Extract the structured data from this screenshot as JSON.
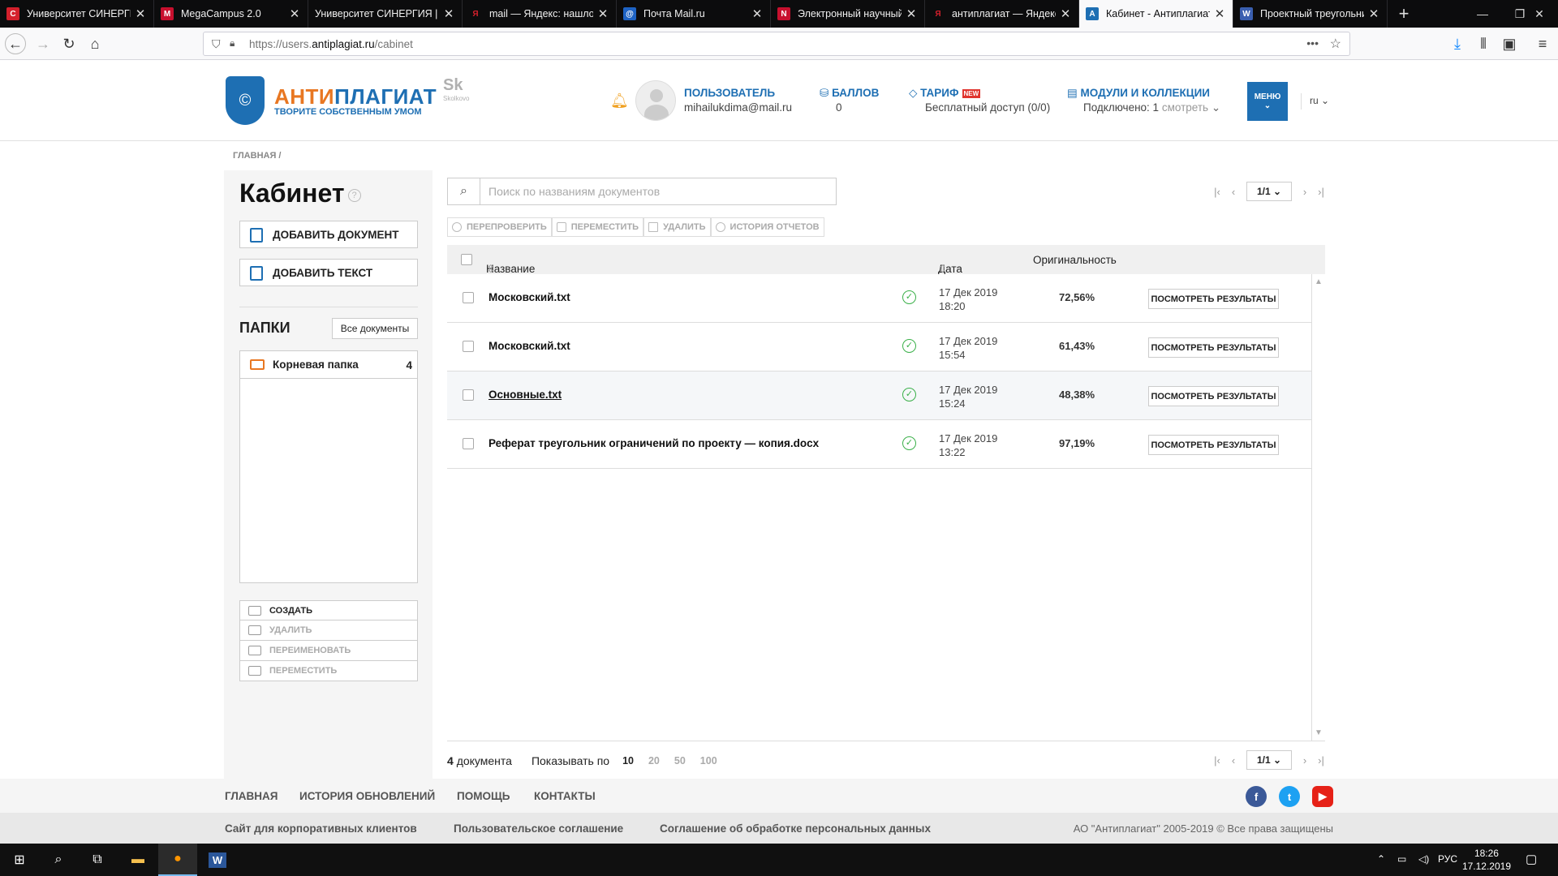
{
  "browser": {
    "tabs": [
      {
        "title": "Университет СИНЕРГИЯ",
        "favicon_color": "#d4202c",
        "favicon_glyph": "С"
      },
      {
        "title": "MegaCampus 2.0",
        "favicon_color": "#c8102e",
        "favicon_glyph": "M"
      },
      {
        "title": "Университет СИНЕРГИЯ | Э",
        "favicon_color": "#555555",
        "favicon_glyph": ""
      },
      {
        "title": "mail — Яндекс: нашлось",
        "favicon_color": "#d4202c",
        "favicon_glyph": "Я"
      },
      {
        "title": "Почта Mail.ru",
        "favicon_color": "#1e63c4",
        "favicon_glyph": "@"
      },
      {
        "title": "Электронный научный",
        "favicon_color": "#c8102e",
        "favicon_glyph": "N"
      },
      {
        "title": "антиплагиат — Яндекс",
        "favicon_color": "#d4202c",
        "favicon_glyph": "Я"
      },
      {
        "title": "Кабинет - Антиплагиат",
        "favicon_color": "#1e6fb3",
        "favicon_glyph": "А",
        "active": true
      },
      {
        "title": "Проектный треугольник",
        "favicon_color": "#3a5fb0",
        "favicon_glyph": "W"
      }
    ],
    "url_prefix": "https://users.",
    "url_domain": "antiplagiat.ru",
    "url_path": "/cabinet"
  },
  "header": {
    "logo_part1": "АНТИ",
    "logo_part2": "ПЛАГИАТ",
    "logo_slogan": "ТВОРИТЕ СОБСТВЕННЫМ УМОМ",
    "skolkovo": "Sk",
    "skolkovo_sub": "Skolkovo",
    "user_label": "ПОЛЬЗОВАТЕЛЬ",
    "user_email": "mihailukdima@mail.ru",
    "points_label": "БАЛЛОВ",
    "points_value": "0",
    "tariff_label": "ТАРИФ",
    "tariff_badge": "NEW",
    "tariff_value": "Бесплатный доступ (0/0)",
    "modules_label": "МОДУЛИ И КОЛЛЕКЦИИ",
    "modules_connected": "Подключено: 1",
    "modules_view": "смотреть",
    "menu_label": "МЕНЮ",
    "lang": "ru"
  },
  "breadcrumb": "ГЛАВНАЯ /",
  "sidebar": {
    "title": "Кабинет",
    "add_document": "ДОБАВИТЬ ДОКУМЕНТ",
    "add_text": "ДОБАВИТЬ ТЕКСТ",
    "folders_heading": "ПАПКИ",
    "all_documents": "Все документы",
    "folders": [
      {
        "name": "Корневая папка",
        "count": "4"
      }
    ],
    "folder_actions": [
      "СОЗДАТЬ",
      "УДАЛИТЬ",
      "ПЕРЕИМЕНОВАТЬ",
      "ПЕРЕМЕСТИТЬ"
    ]
  },
  "main": {
    "search_placeholder": "Поиск по названиям документов",
    "page_indicator": "1/1",
    "actions": [
      "ПЕРЕПРОВЕРИТЬ",
      "ПЕРЕМЕСТИТЬ",
      "УДАЛИТЬ",
      "ИСТОРИЯ ОТЧЕТОВ"
    ],
    "columns": {
      "name": "Название",
      "date": "Дата загрузки",
      "originality": "Оригинальность"
    },
    "rows": [
      {
        "name": "Московский.txt",
        "date": "17 Дек 2019",
        "time": "18:20",
        "originality": "72,56%",
        "action": "ПОСМОТРЕТЬ РЕЗУЛЬТАТЫ"
      },
      {
        "name": "Московский.txt",
        "date": "17 Дек 2019",
        "time": "15:54",
        "originality": "61,43%",
        "action": "ПОСМОТРЕТЬ РЕЗУЛЬТАТЫ"
      },
      {
        "name": "Основные.txt",
        "date": "17 Дек 2019",
        "time": "15:24",
        "originality": "48,38%",
        "action": "ПОСМОТРЕТЬ РЕЗУЛЬТАТЫ"
      },
      {
        "name": "Реферат треугольник ограничений по проекту — копия.docx",
        "date": "17 Дек 2019",
        "time": "13:22",
        "originality": "97,19%",
        "action": "ПОСМОТРЕТЬ РЕЗУЛЬТАТЫ"
      }
    ],
    "doc_count": "4",
    "doc_count_label": "документа",
    "show_by_label": "Показывать по",
    "page_sizes": [
      "10",
      "20",
      "50",
      "100"
    ]
  },
  "footer": {
    "links": [
      "ГЛАВНАЯ",
      "ИСТОРИЯ ОБНОВЛЕНИЙ",
      "ПОМОЩЬ",
      "КОНТАКТЫ"
    ],
    "links2": [
      "Сайт для корпоративных клиентов",
      "Пользовательское соглашение",
      "Соглашение об обработке персональных данных"
    ],
    "copyright": "АО \"Антиплагиат\" 2005-2019 © Все права защищены"
  },
  "taskbar": {
    "lang": "РУС",
    "time": "18:26",
    "date": "17.12.2019"
  },
  "colors": {
    "brand_blue": "#1e6fb3",
    "brand_orange": "#e87722",
    "ok_green": "#3ab049"
  }
}
